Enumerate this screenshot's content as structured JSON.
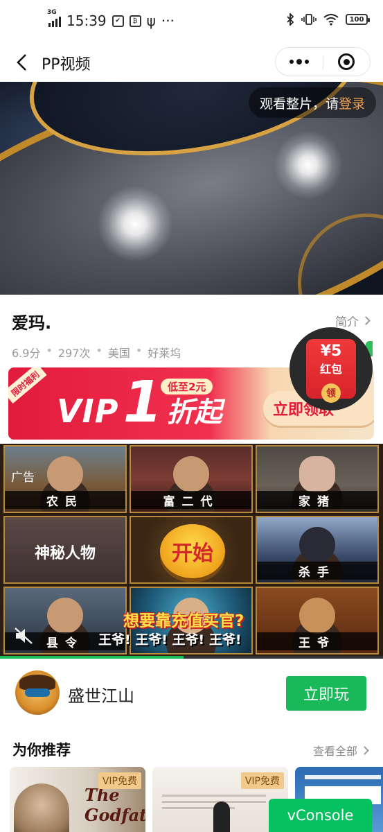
{
  "status_bar": {
    "network": "3G",
    "time": "15:39",
    "icon_labels": [
      "✔",
      "₿",
      "ψ",
      "···"
    ],
    "battery": "100"
  },
  "nav": {
    "title": "PP视频"
  },
  "video": {
    "login_prefix": "观看整片，请",
    "login_link": "登录"
  },
  "movie": {
    "title": "爱玛.",
    "intro_label": "简介",
    "meta": {
      "score": "6.9分",
      "plays": "297次",
      "region": "美国",
      "source": "好莱坞"
    },
    "meta_sep": "•"
  },
  "red_packet": {
    "amount": "¥5",
    "label": "红包",
    "button": "领"
  },
  "vip_banner": {
    "tag": "限时福利",
    "word": "VIP",
    "number": "1",
    "suffix": "折起",
    "low_price": "低至2元",
    "cta": "立即领取"
  },
  "ad": {
    "label": "广告",
    "cells": [
      "农民",
      "富二代",
      "家猪",
      "神秘人物",
      "开始",
      "杀手",
      "县令",
      "",
      "王爷"
    ],
    "promo_big": "想要靠充值买官?",
    "promo_sub": "王爷! 王爷! 王爷! 王爷!",
    "progress": 0.48
  },
  "game": {
    "name": "盛世江山",
    "play": "立即玩"
  },
  "recommend": {
    "title": "为你推荐",
    "view_all": "查看全部",
    "cards": [
      {
        "badge": "VIP免费",
        "title": "The Godfather"
      },
      {
        "badge": "VIP免费"
      },
      {}
    ]
  },
  "vconsole": "vConsole",
  "colors": {
    "accent_green": "#19b95a",
    "vip_red": "#e21b3c",
    "login_orange": "#f3a34c"
  }
}
